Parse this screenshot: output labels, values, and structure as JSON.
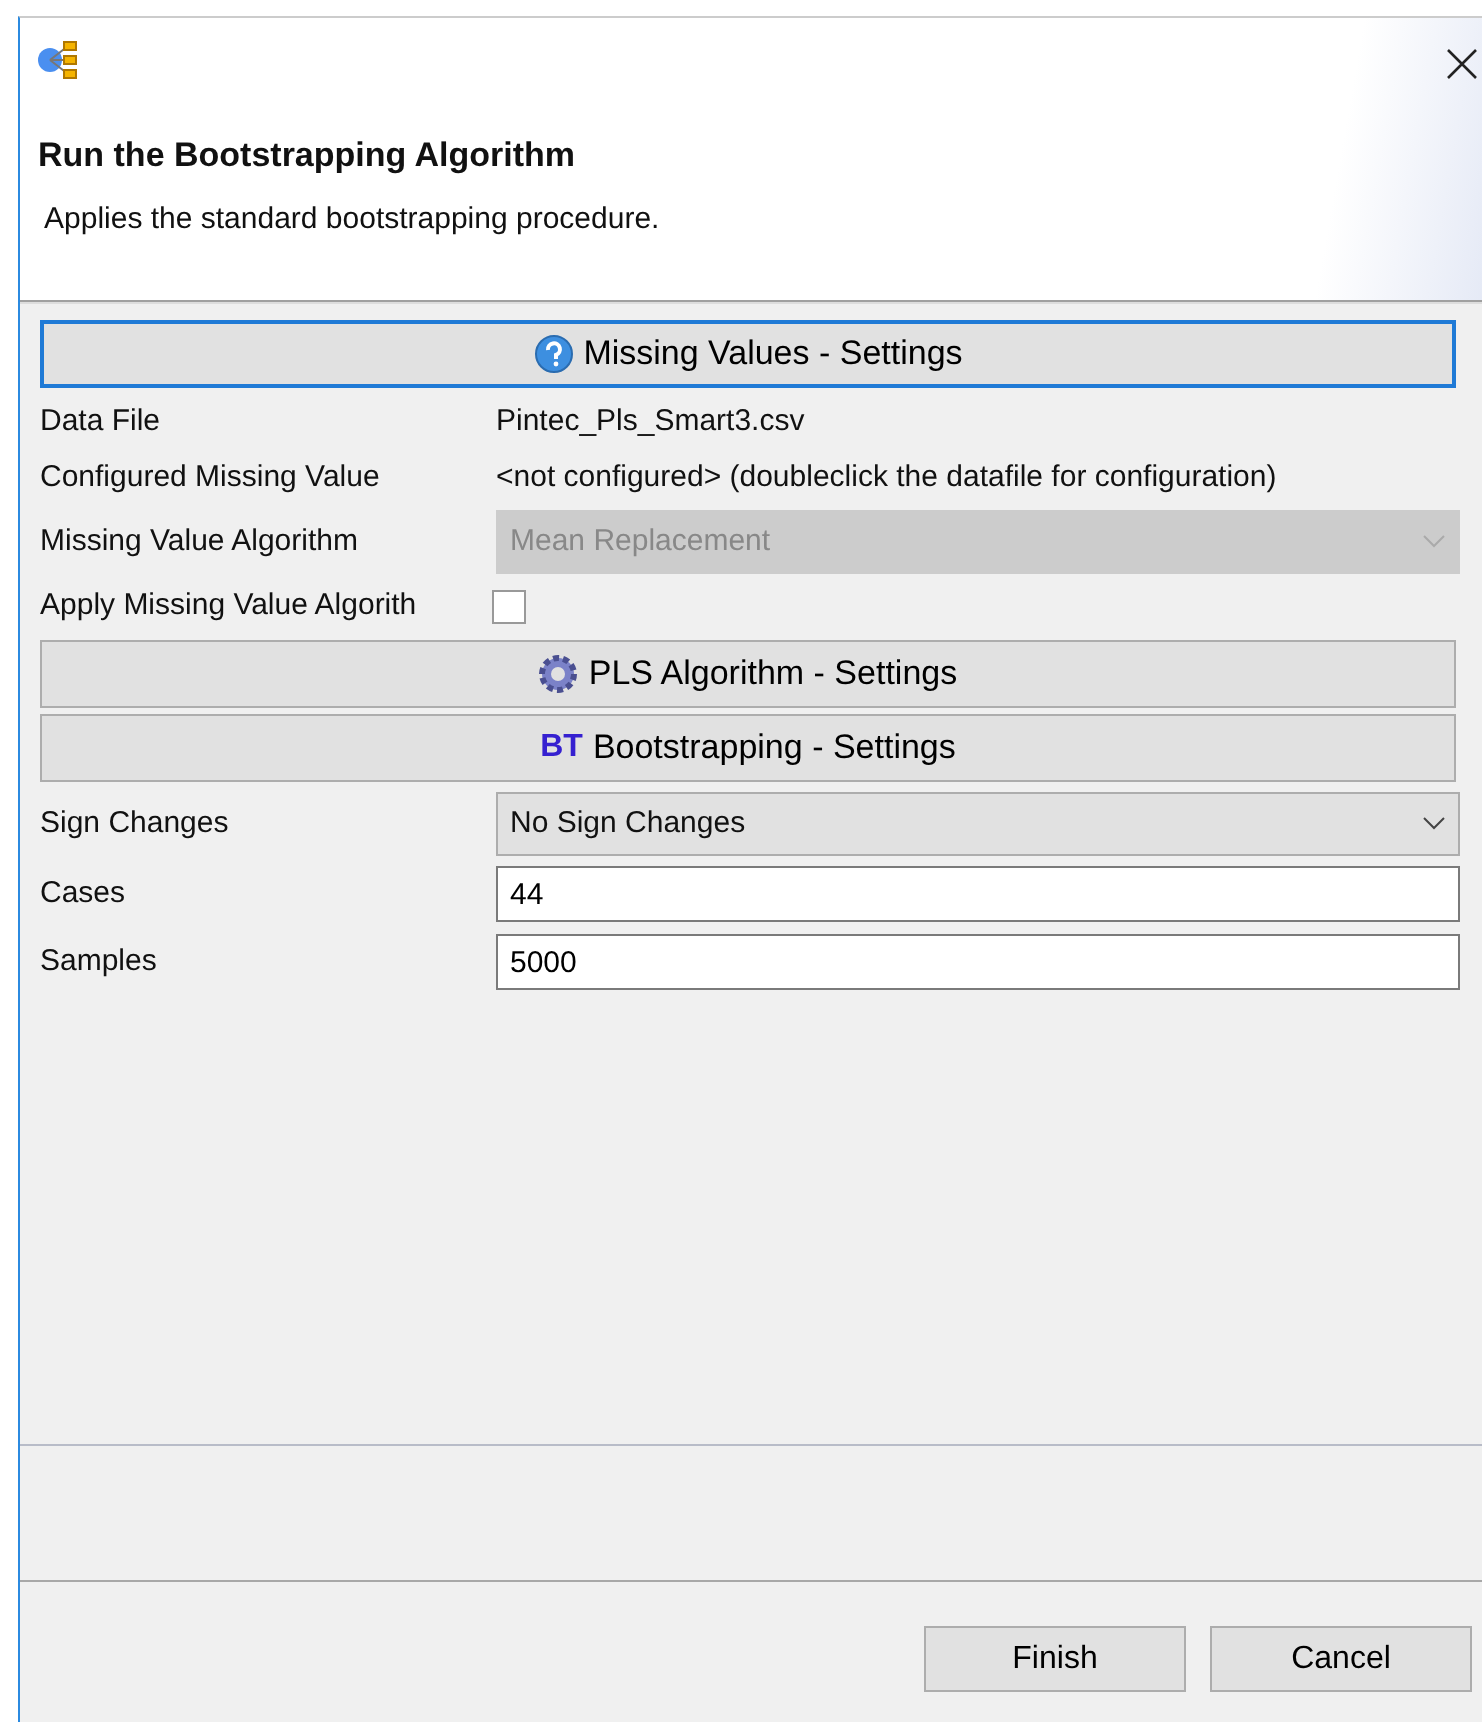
{
  "header": {
    "title": "Run the Bootstrapping Algorithm",
    "description": "Applies the standard bootstrapping procedure."
  },
  "items": [
    {
      "kind": "section",
      "label": "Missing Values - Settings",
      "focused": true
    },
    {
      "kind": "text",
      "label": "Data File",
      "value": "Pintec_Pls_Smart3.csv"
    },
    {
      "kind": "text",
      "label": "Configured Missing Value",
      "value": "<not configured> (doubleclick the datafile for configuration)"
    },
    {
      "kind": "select",
      "label": "Missing Value Algorithm",
      "value": "Mean Replacement",
      "disabled": true
    },
    {
      "kind": "checkbox",
      "label": "Apply Missing Value Algorith",
      "checked": false
    },
    {
      "kind": "section",
      "label": "PLS Algorithm - Settings",
      "focused": false
    },
    {
      "kind": "section",
      "label": "Bootstrapping - Settings",
      "icon_text": "BT",
      "focused": false
    },
    {
      "kind": "select",
      "label": "Sign Changes",
      "value": "No Sign Changes",
      "disabled": false
    },
    {
      "kind": "input",
      "label": "Cases",
      "value": "44"
    },
    {
      "kind": "input",
      "label": "Samples",
      "value": "5000"
    }
  ],
  "buttons": [
    {
      "label": "Finish"
    },
    {
      "label": "Cancel"
    }
  ]
}
